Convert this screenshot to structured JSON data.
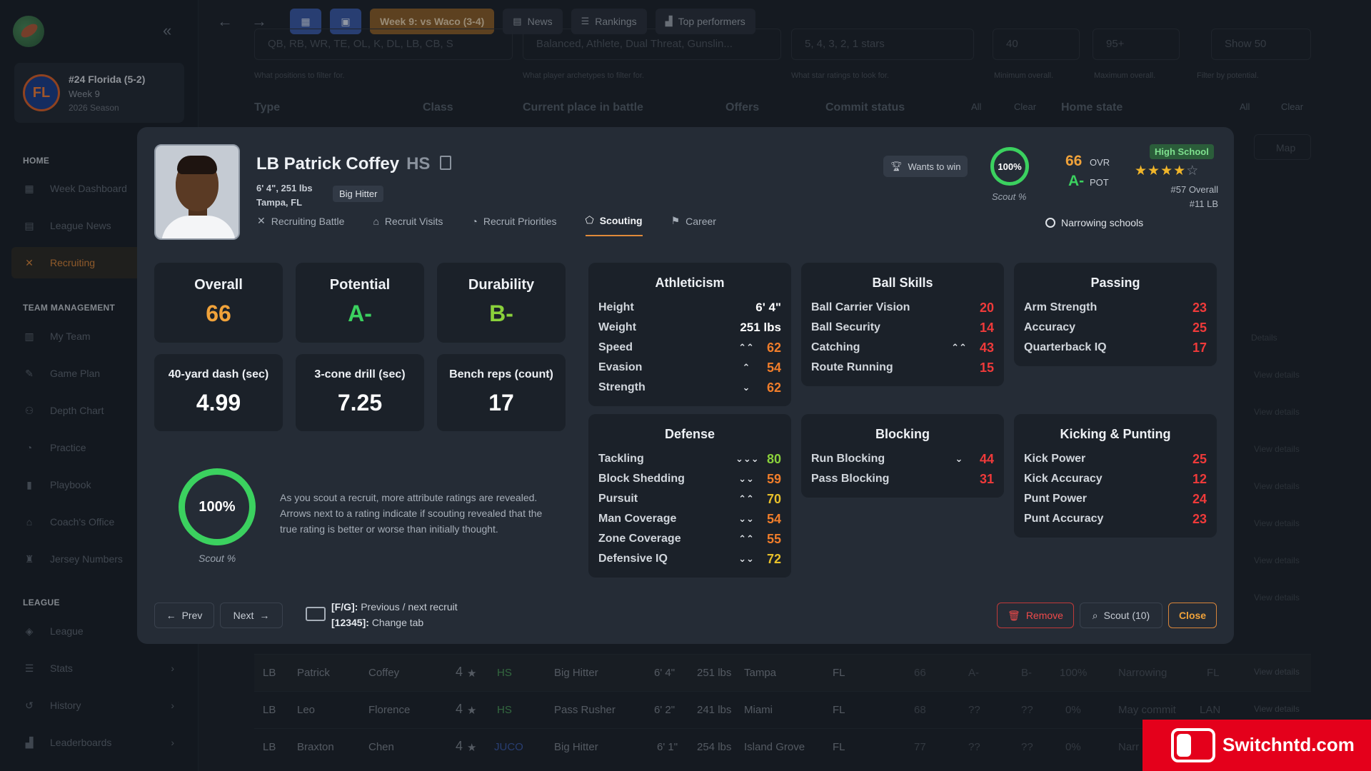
{
  "sidebar": {
    "team": {
      "initials": "FL",
      "name": "#24 Florida (5-2)",
      "week": "Week 9",
      "season": "2026 Season"
    },
    "sections": [
      {
        "title": "HOME"
      },
      {
        "title": "TEAM MANAGEMENT"
      },
      {
        "title": "LEAGUE"
      }
    ],
    "items": [
      {
        "label": "Week Dashboard",
        "icon": "grid-icon"
      },
      {
        "label": "League News",
        "icon": "news-icon"
      },
      {
        "label": "Recruiting",
        "icon": "recruiting-icon"
      },
      {
        "label": "My Team",
        "icon": "team-icon"
      },
      {
        "label": "Game Plan",
        "icon": "gameplan-icon"
      },
      {
        "label": "Depth Chart",
        "icon": "depth-icon"
      },
      {
        "label": "Practice",
        "icon": "whistle-icon"
      },
      {
        "label": "Playbook",
        "icon": "book-icon"
      },
      {
        "label": "Coach's Office",
        "icon": "office-icon"
      },
      {
        "label": "Jersey Numbers",
        "icon": "jersey-icon"
      },
      {
        "label": "League",
        "icon": "layers-icon"
      },
      {
        "label": "Stats",
        "icon": "database-icon"
      },
      {
        "label": "History",
        "icon": "history-icon"
      },
      {
        "label": "Leaderboards",
        "icon": "leaderboard-icon"
      }
    ]
  },
  "topbar": {
    "week": "Week 9: vs Waco (3-4)",
    "news": "News",
    "rankings": "Rankings",
    "top_performers": "Top performers"
  },
  "filters": {
    "positions_value": "QB, RB, WR, TE, OL, K, DL, LB, CB, S",
    "positions_hint": "What positions to filter for.",
    "archetypes_value": "Balanced, Athlete, Dual Threat, Gunslin...",
    "archetypes_hint": "What player archetypes to filter for.",
    "stars_value": "5, 4, 3, 2, 1 stars",
    "stars_hint": "What star ratings to look for.",
    "min_value": "40",
    "min_hint": "Minimum overall.",
    "max_value": "95+",
    "max_hint": "Maximum overall.",
    "show_value": "Show 50",
    "show_hint": "Filter by potential.",
    "columns": [
      "Type",
      "Class",
      "Current place in battle",
      "Offers",
      "Commit status",
      "All",
      "Clear",
      "Home state",
      "All",
      "Clear"
    ],
    "map_label": "Map"
  },
  "player": {
    "name": "LB Patrick Coffey",
    "class_tag": "HS",
    "size": "6' 4\", 251 lbs",
    "hometown": "Tampa, FL",
    "archetype": "Big Hitter",
    "wants": "Wants to win",
    "scout_pct": "100%",
    "scout_label": "Scout %",
    "ovr": "66",
    "ovr_label": "OVR",
    "pot": "A-",
    "pot_label": "POT",
    "school_type": "High School",
    "stars": 4,
    "rank_overall": "#57 Overall",
    "rank_pos": "#11 LB",
    "narrowing": "Narrowing schools"
  },
  "tabs": [
    "Recruiting Battle",
    "Recruit Visits",
    "Recruit Priorities",
    "Scouting",
    "Career"
  ],
  "summary": {
    "overall_label": "Overall",
    "overall": "66",
    "potential_label": "Potential",
    "potential": "A-",
    "durability_label": "Durability",
    "durability": "B-",
    "dash_label": "40-yard dash (sec)",
    "dash": "4.99",
    "cone_label": "3-cone drill (sec)",
    "cone": "7.25",
    "bench_label": "Bench reps (count)",
    "bench": "17",
    "scout_pct": "100%",
    "scout_label": "Scout %",
    "scout_desc": "As you scout a recruit, more attribute ratings are revealed. Arrows next to a rating indicate if scouting revealed that the true rating is better or worse than initially thought."
  },
  "attributes": {
    "athleticism": {
      "title": "Athleticism",
      "rows": [
        {
          "name": "Height",
          "arrow": "",
          "value": "6' 4\"",
          "color": "#ffffff"
        },
        {
          "name": "Weight",
          "arrow": "",
          "value": "251 lbs",
          "color": "#ffffff"
        },
        {
          "name": "Speed",
          "arrow": "⌃⌃",
          "value": "62",
          "color": "#f07d2a"
        },
        {
          "name": "Evasion",
          "arrow": "⌃",
          "value": "54",
          "color": "#f07d2a"
        },
        {
          "name": "Strength",
          "arrow": "⌄",
          "value": "62",
          "color": "#f07d2a"
        }
      ]
    },
    "ball_skills": {
      "title": "Ball Skills",
      "rows": [
        {
          "name": "Ball Carrier Vision",
          "arrow": "",
          "value": "20",
          "color": "#ef3a3a"
        },
        {
          "name": "Ball Security",
          "arrow": "",
          "value": "14",
          "color": "#ef3a3a"
        },
        {
          "name": "Catching",
          "arrow": "⌃⌃",
          "value": "43",
          "color": "#ef3a3a"
        },
        {
          "name": "Route Running",
          "arrow": "",
          "value": "15",
          "color": "#ef3a3a"
        }
      ]
    },
    "passing": {
      "title": "Passing",
      "rows": [
        {
          "name": "Arm Strength",
          "arrow": "",
          "value": "23",
          "color": "#ef3a3a"
        },
        {
          "name": "Accuracy",
          "arrow": "",
          "value": "25",
          "color": "#ef3a3a"
        },
        {
          "name": "Quarterback IQ",
          "arrow": "",
          "value": "17",
          "color": "#ef3a3a"
        }
      ]
    },
    "defense": {
      "title": "Defense",
      "rows": [
        {
          "name": "Tackling",
          "arrow": "⌄⌄⌄",
          "value": "80",
          "color": "#8ad13b"
        },
        {
          "name": "Block Shedding",
          "arrow": "⌄⌄",
          "value": "59",
          "color": "#f07d2a"
        },
        {
          "name": "Pursuit",
          "arrow": "⌃⌃",
          "value": "70",
          "color": "#e8c02a"
        },
        {
          "name": "Man Coverage",
          "arrow": "⌄⌄",
          "value": "54",
          "color": "#f07d2a"
        },
        {
          "name": "Zone Coverage",
          "arrow": "⌃⌃",
          "value": "55",
          "color": "#f07d2a"
        },
        {
          "name": "Defensive IQ",
          "arrow": "⌄⌄",
          "value": "72",
          "color": "#e8c02a"
        }
      ]
    },
    "blocking": {
      "title": "Blocking",
      "rows": [
        {
          "name": "Run Blocking",
          "arrow": "⌄",
          "value": "44",
          "color": "#ef3a3a"
        },
        {
          "name": "Pass Blocking",
          "arrow": "",
          "value": "31",
          "color": "#ef3a3a"
        }
      ]
    },
    "kicking": {
      "title": "Kicking & Punting",
      "rows": [
        {
          "name": "Kick Power",
          "arrow": "",
          "value": "25",
          "color": "#ef3a3a"
        },
        {
          "name": "Kick Accuracy",
          "arrow": "",
          "value": "12",
          "color": "#ef3a3a"
        },
        {
          "name": "Punt Power",
          "arrow": "",
          "value": "24",
          "color": "#ef3a3a"
        },
        {
          "name": "Punt Accuracy",
          "arrow": "",
          "value": "23",
          "color": "#ef3a3a"
        }
      ]
    }
  },
  "footer": {
    "prev": "Prev",
    "next": "Next",
    "kb_line1_key": "[F/G]:",
    "kb_line1": "Previous / next recruit",
    "kb_line2_key": "[12345]:",
    "kb_line2": "Change tab",
    "remove": "Remove",
    "scout": "Scout (10)",
    "close": "Close"
  },
  "table": {
    "rows": [
      {
        "pos": "LB",
        "first": "Patrick",
        "last": "Coffey",
        "stars": "4",
        "cls": "HS",
        "arch": "Big Hitter",
        "ht": "6' 4\"",
        "wt": "251 lbs",
        "city": "Tampa",
        "st": "FL",
        "ovr": "66",
        "pot": "A-",
        "dur": "B-",
        "scout": "100%",
        "status": "Narrowing",
        "top": "FL",
        "link": "View details"
      },
      {
        "pos": "LB",
        "first": "Leo",
        "last": "Florence",
        "stars": "4",
        "cls": "HS",
        "arch": "Pass Rusher",
        "ht": "6' 2\"",
        "wt": "241 lbs",
        "city": "Miami",
        "st": "FL",
        "ovr": "68",
        "pot": "??",
        "dur": "??",
        "scout": "0%",
        "status": "May commit",
        "top": "LAN",
        "link": "View details"
      },
      {
        "pos": "LB",
        "first": "Braxton",
        "last": "Chen",
        "stars": "4",
        "cls": "JUCO",
        "arch": "Big Hitter",
        "ht": "6' 1\"",
        "wt": "254 lbs",
        "city": "Island Grove",
        "st": "FL",
        "ovr": "77",
        "pot": "??",
        "dur": "??",
        "scout": "0%",
        "status": "Narr",
        "top": "",
        "link": ""
      }
    ],
    "right_links": [
      "Details",
      "View details",
      "View details",
      "View details",
      "View details",
      "View details",
      "View details",
      "View details"
    ]
  },
  "watermark": "Switchntd.com"
}
